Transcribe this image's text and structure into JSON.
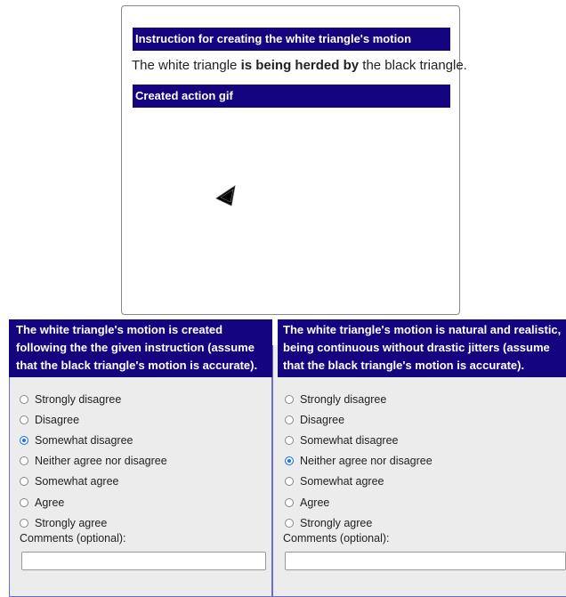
{
  "task": {
    "instruction_header": "Instruction for creating the white triangle's motion",
    "instruction_pre": "The white triangle ",
    "instruction_bold": "is being herded by",
    "instruction_post": " the black triangle.",
    "gif_header": "Created action gif"
  },
  "questions": [
    {
      "prompt": "The white triangle's motion is created following the the given instruction (assume that the black triangle's motion is accurate).",
      "options": [
        "Strongly disagree",
        "Disagree",
        "Somewhat disagree",
        "Neither agree nor disagree",
        "Somewhat agree",
        "Agree",
        "Strongly agree"
      ],
      "selected": "Somewhat disagree",
      "comments_label": "Comments (optional):",
      "comments_value": ""
    },
    {
      "prompt": "The white triangle's motion is natural and realistic, being continuous without drastic jitters (assume that the black triangle's motion is accurate).",
      "options": [
        "Strongly disagree",
        "Disagree",
        "Somewhat disagree",
        "Neither agree nor disagree",
        "Somewhat agree",
        "Agree",
        "Strongly agree"
      ],
      "selected": "Neither agree nor disagree",
      "comments_label": "Comments (optional):",
      "comments_value": ""
    }
  ],
  "colors": {
    "header_bg": "#14047f",
    "panel_bg": "#ececec",
    "radio_selected": "#1a73e8"
  }
}
